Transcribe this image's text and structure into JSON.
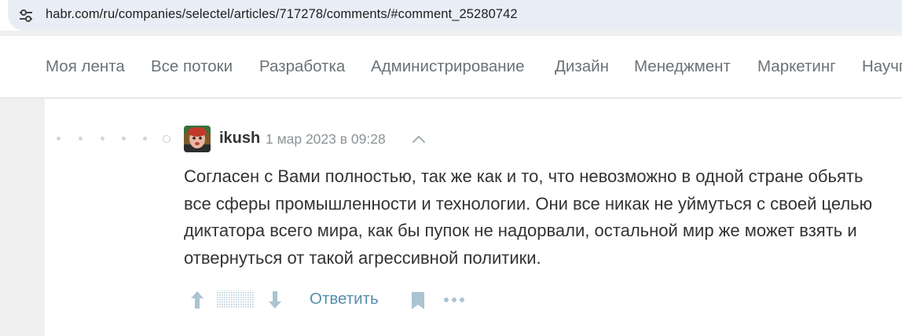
{
  "browser": {
    "url": "habr.com/ru/companies/selectel/articles/717278/comments/#comment_25280742",
    "site_info_icon": "tune-icon"
  },
  "nav": {
    "items": [
      {
        "label": "Моя лента"
      },
      {
        "label": "Все потоки"
      },
      {
        "label": "Разработка"
      },
      {
        "label": "Администрирование"
      },
      {
        "label": "Дизайн"
      },
      {
        "label": "Менеджмент"
      },
      {
        "label": "Маркетинг"
      },
      {
        "label": "Научпоп"
      }
    ]
  },
  "comment": {
    "author": "ikush",
    "date": "1 мар 2023 в 09:28",
    "text": "Согласен с Вами полностью, так же как и то, что невозможно в одной стране обьять все сферы промышленности и технологии. Они все никак не уймуться с своей целью диктатора всего мира, как бы пупок не надорвали, остальной мир же может взять и отвернуться от такой агрессивной политики.",
    "actions": {
      "reply_label": "Ответить",
      "upvote_icon": "arrow-up-icon",
      "downvote_icon": "arrow-down-icon",
      "bookmark_icon": "bookmark-icon",
      "more_icon": "more-dots-icon",
      "collapse_icon": "chevron-up-icon"
    }
  },
  "colors": {
    "link": "#548eaa",
    "nav_text": "#6b7277",
    "muted": "#8c9396",
    "icon": "#aac4d2"
  }
}
